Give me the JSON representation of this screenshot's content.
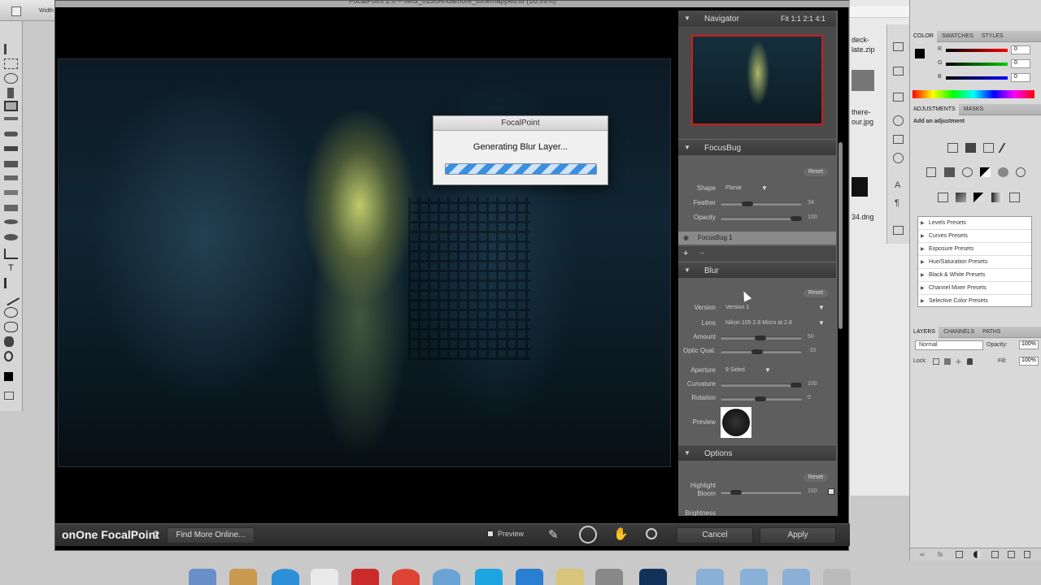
{
  "ps_toolbar": {
    "width_label": "Width"
  },
  "filestrip": {
    "file1": "deck-",
    "file2": "late.zip",
    "file3": "there-",
    "file4": "our.jpg",
    "file5": "34.dng"
  },
  "fp": {
    "title": "FocalPoint 2.0 – IMG_0130Andamore_tonemapped.tif (18.99%)",
    "dialog": {
      "title": "FocalPoint",
      "message": "Generating Blur Layer...",
      "progress": 1.0
    },
    "navigator": {
      "label": "Navigator",
      "zoom_options": "Fit  1:1  2:1  4:1"
    },
    "focusbug": {
      "label": "FocusBug",
      "reset": "Reset",
      "shape_label": "Shape",
      "shape_value": "Planar",
      "feather_label": "Feather",
      "feather_value": "34",
      "opacity_label": "Opacity",
      "opacity_value": "100",
      "layer_name": "FocusBug 1",
      "add": "+",
      "remove": "−"
    },
    "blur": {
      "label": "Blur",
      "reset": "Reset",
      "version_label": "Version",
      "version_value": "Version 1",
      "lens_label": "Lens",
      "lens_value": "Nikon 105 2.8 Micro at 2.8",
      "amount_label": "Amount",
      "amount_value": "50",
      "optic_label": "Optic Qual.",
      "optic_value": "-10",
      "aperture_label": "Aperture",
      "aperture_value": "9 Sided",
      "curvature_label": "Curvature",
      "curvature_value": "100",
      "rotation_label": "Rotation",
      "rotation_value": "0",
      "preview_label": "Preview"
    },
    "options": {
      "label": "Options",
      "reset": "Reset",
      "bloom_label_1": "Highlight",
      "bloom_label_2": "Bloom",
      "bloom_value": "150",
      "brightness_label": "Brightness"
    },
    "bottom": {
      "logo": "onOne FocalPoint",
      "logo_num": "2",
      "find_more": "Find More Online...",
      "preview": "Preview",
      "cancel": "Cancel",
      "apply": "Apply"
    }
  },
  "ps_panels": {
    "tab_color": "COLOR",
    "tab_swatches": "SWATCHES",
    "tab_styles": "STYLES",
    "r": "R",
    "g": "G",
    "b": "B",
    "r_val": "0",
    "g_val": "0",
    "b_val": "0",
    "tab_adjustments": "ADJUSTMENTS",
    "tab_masks": "MASKS",
    "add_adjustment": "Add an adjustment",
    "presets": [
      "Levels Presets",
      "Curves Presets",
      "Exposure Presets",
      "Hue/Saturation Presets",
      "Black & White Presets",
      "Channel Mixer Presets",
      "Selective Color Presets"
    ],
    "tab_layers": "LAYERS",
    "tab_channels": "CHANNELS",
    "tab_paths": "PATHS",
    "blend_mode": "Normal",
    "opacity_label": "Opacity:",
    "opacity_value": "100%",
    "lock_label": "Lock:",
    "fill_label": "Fill:",
    "fill_value": "100%"
  }
}
